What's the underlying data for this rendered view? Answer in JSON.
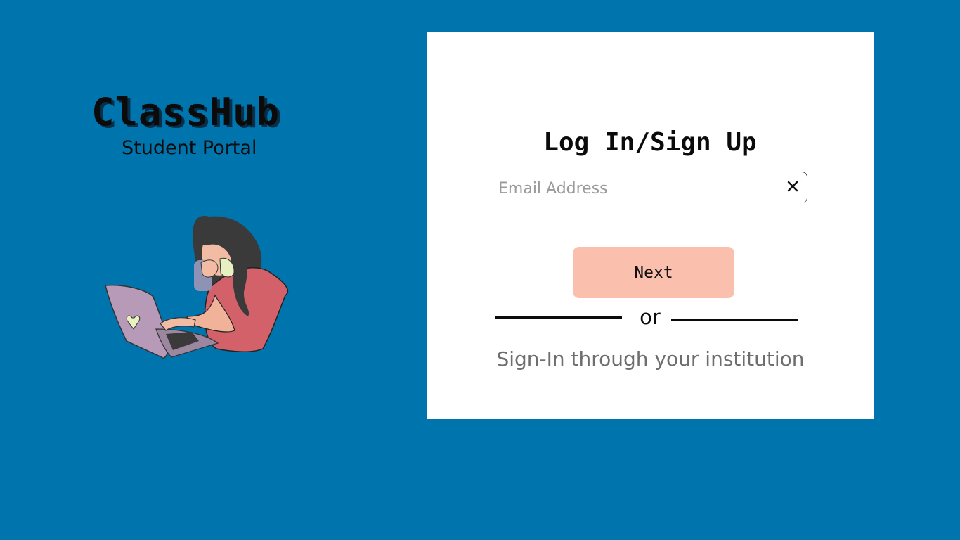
{
  "brand": {
    "title": "ClassHub",
    "subtitle": "Student Portal",
    "illustration_icon": "student-with-laptop-illustration"
  },
  "login": {
    "title": "Log In/Sign Up",
    "email_placeholder": "Email Address",
    "email_value": "",
    "clear_icon": "close-icon",
    "next_label": "Next",
    "divider_text": "or",
    "institution_link": "Sign-In through your institution"
  },
  "colors": {
    "background": "#0074ad",
    "card": "#ffffff",
    "next_button": "#fbc0ad",
    "link_text": "#6e6e6e"
  }
}
